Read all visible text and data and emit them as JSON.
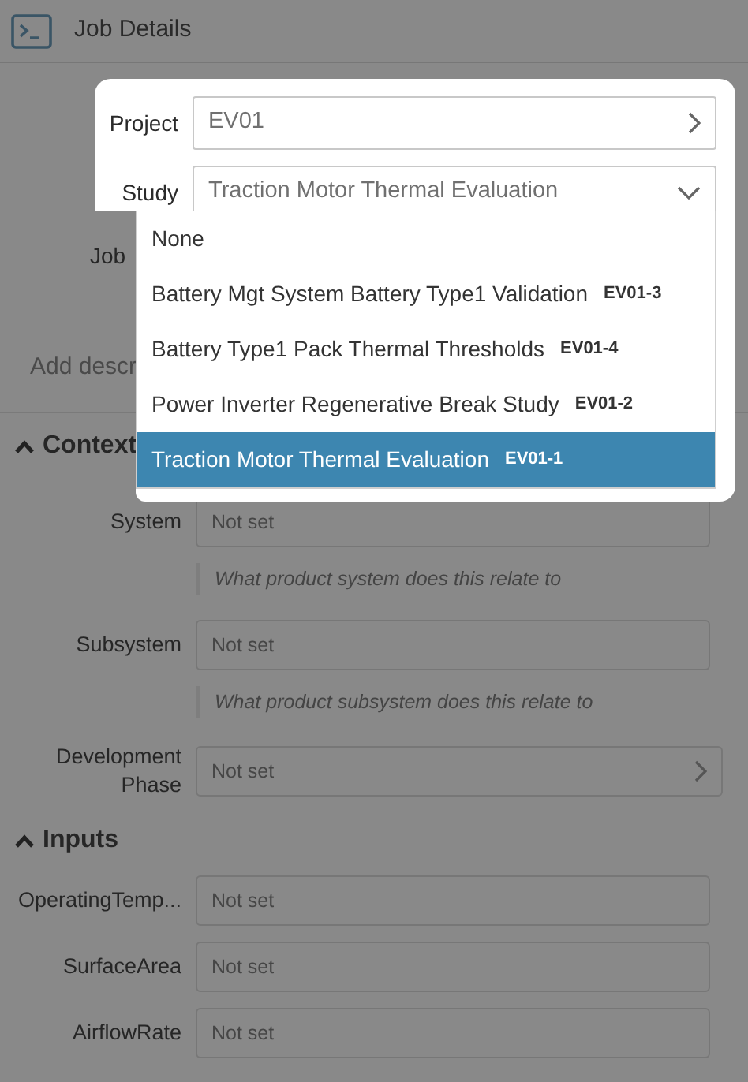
{
  "header": {
    "title": "Job Details"
  },
  "background": {
    "partial_label": "Job",
    "description_placeholder": "Add descr",
    "sections": [
      {
        "title": "Context",
        "expanded": true,
        "rows": [
          {
            "label": "System",
            "placeholder": "Not set",
            "hint": "What product system does this relate to",
            "kind": "text"
          },
          {
            "label": "Subsystem",
            "placeholder": "Not set",
            "hint": "What product subsystem does this relate to",
            "kind": "text"
          },
          {
            "label": "Development Phase",
            "placeholder": "Not set",
            "kind": "link"
          }
        ]
      },
      {
        "title": "Inputs",
        "expanded": true,
        "rows": [
          {
            "label": "OperatingTemp...",
            "placeholder": "Not set",
            "kind": "text"
          },
          {
            "label": "SurfaceArea",
            "placeholder": "Not set",
            "kind": "text"
          },
          {
            "label": "AirflowRate",
            "placeholder": "Not set",
            "kind": "text"
          }
        ]
      }
    ]
  },
  "popup": {
    "fields": [
      {
        "label": "Project",
        "value": "EV01",
        "kind": "link"
      },
      {
        "label": "Study",
        "value": "Traction Motor Thermal Evaluation",
        "kind": "select",
        "expanded": true
      }
    ],
    "options": [
      {
        "name": "None",
        "selected": false
      },
      {
        "name": "Battery Mgt System Battery Type1 Validation",
        "code": "EV01-3",
        "selected": false
      },
      {
        "name": "Battery Type1 Pack Thermal Thresholds",
        "code": "EV01-4",
        "selected": false
      },
      {
        "name": "Power Inverter Regenerative Break Study",
        "code": "EV01-2",
        "selected": false
      },
      {
        "name": "Traction Motor Thermal Evaluation",
        "code": "EV01-1",
        "selected": true
      }
    ]
  }
}
